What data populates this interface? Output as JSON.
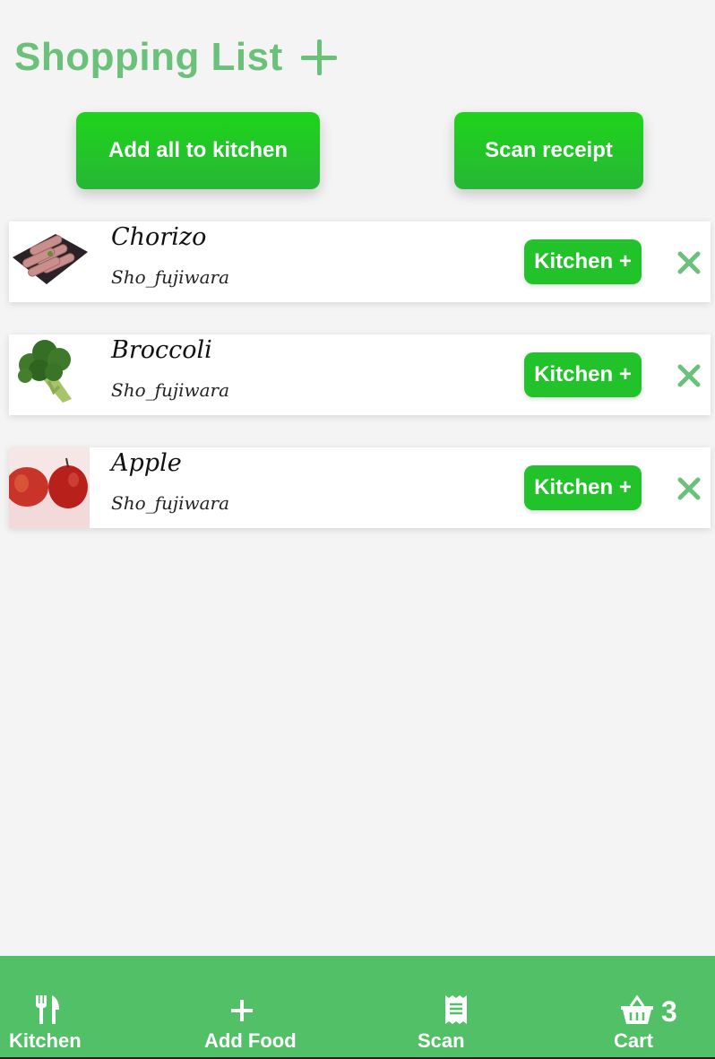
{
  "header": {
    "title": "Shopping List",
    "add_icon": "plus-icon"
  },
  "actions": {
    "add_all_label": "Add all to kitchen",
    "scan_label": "Scan receipt"
  },
  "items": [
    {
      "name": "Chorizo",
      "user": "Sho_fujiwara",
      "kitchen_label": "Kitchen +",
      "image": "chorizo"
    },
    {
      "name": "Broccoli",
      "user": "Sho_fujiwara",
      "kitchen_label": "Kitchen +",
      "image": "broccoli"
    },
    {
      "name": "Apple",
      "user": "Sho_fujiwara",
      "kitchen_label": "Kitchen +",
      "image": "apple"
    }
  ],
  "nav": {
    "kitchen": {
      "label": "Kitchen",
      "icon": "utensils-icon"
    },
    "add_food": {
      "label": "Add Food",
      "icon": "plus-icon"
    },
    "scan": {
      "label": "Scan",
      "icon": "receipt-icon"
    },
    "cart": {
      "label": "Cart",
      "icon": "basket-icon",
      "count": "3"
    }
  },
  "colors": {
    "accent": "#6cc17a",
    "button_green": "#22c22b",
    "nav_bg": "#52c066",
    "background": "#f4f4f4"
  }
}
